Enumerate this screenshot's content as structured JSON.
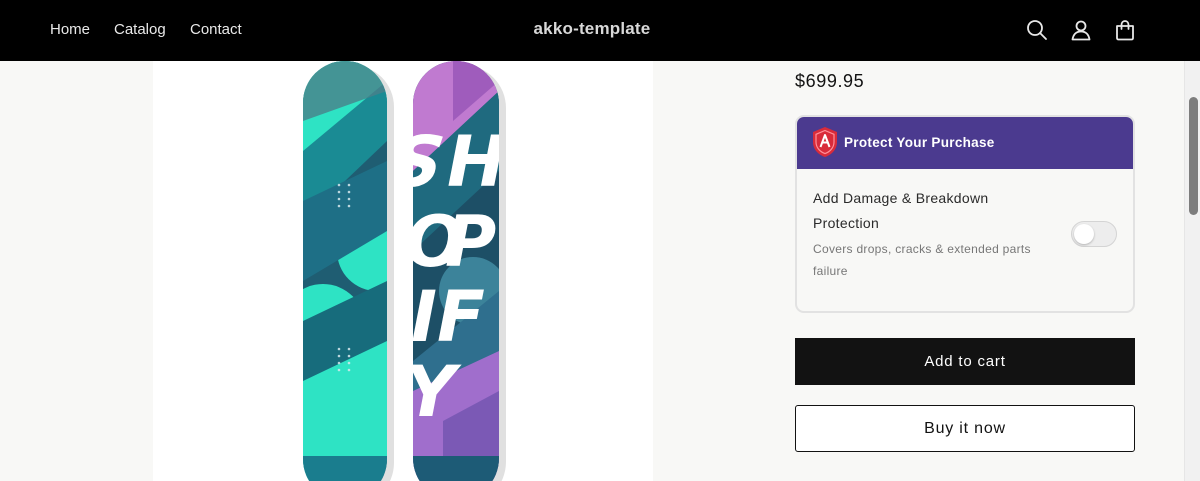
{
  "header": {
    "nav": [
      {
        "label": "Home"
      },
      {
        "label": "Catalog"
      },
      {
        "label": "Contact"
      }
    ],
    "brand": "akko-template",
    "icons": [
      "search-icon",
      "account-icon",
      "cart-icon"
    ]
  },
  "product": {
    "price": "$699.95",
    "image_text": "SHOPIFY"
  },
  "protection": {
    "title": "Protect Your Purchase",
    "label": "Add Damage & Breakdown Protection",
    "subtitle": "Covers drops, cracks & extended parts failure",
    "toggle_on": false,
    "header_color": "#4b3a8f",
    "shield_color": "#d92b3a"
  },
  "actions": {
    "add_to_cart": "Add to cart",
    "buy_now": "Buy it now"
  }
}
